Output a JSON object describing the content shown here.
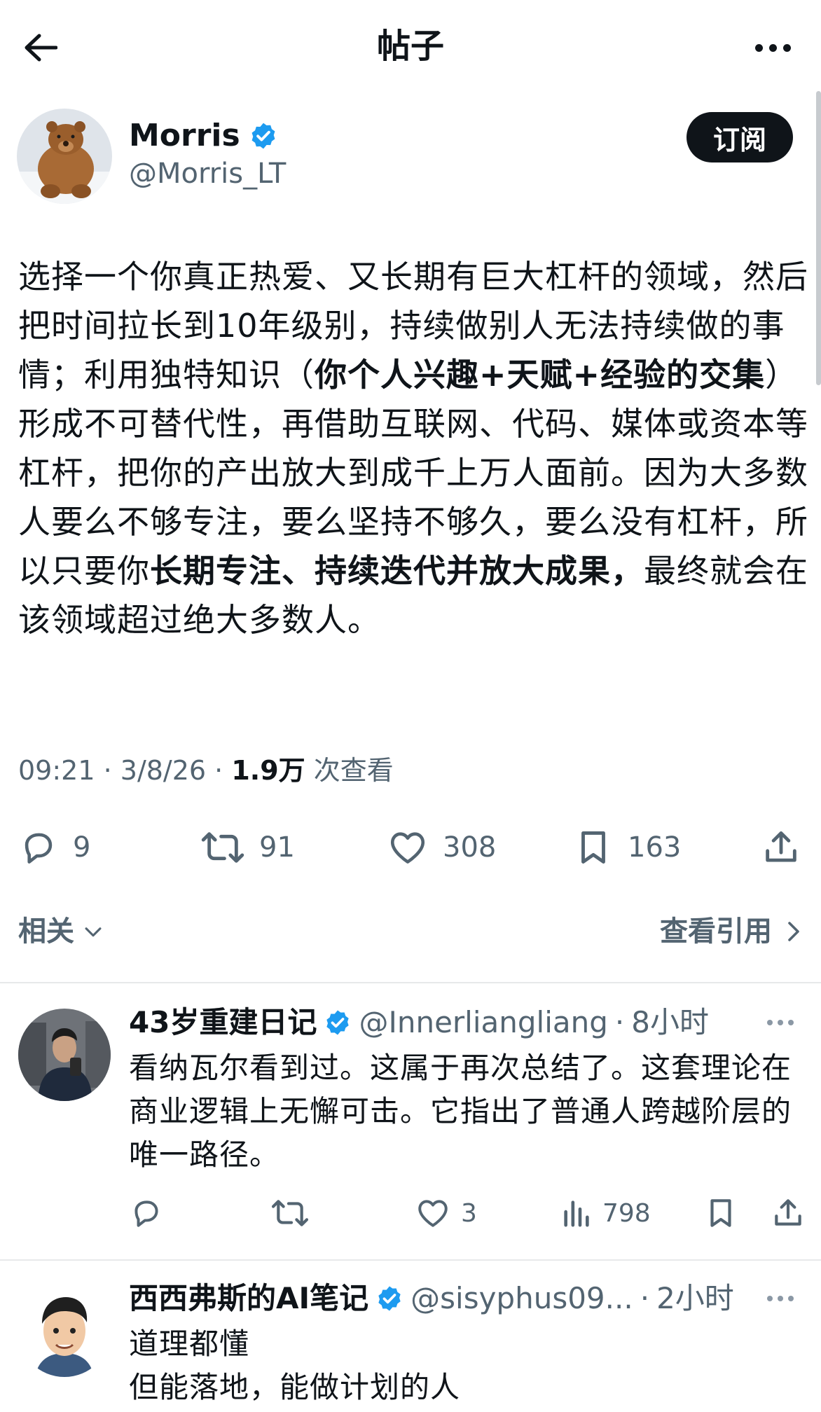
{
  "header": {
    "title": "帖子",
    "back_icon": "arrow-left-icon",
    "more_icon": "more-horizontal-icon"
  },
  "post": {
    "author_name": "Morris",
    "author_handle": "@Morris_LT",
    "subscribe_label": "订阅",
    "body": [
      {
        "text": "选择一个你真正热爱、又长期有巨大杠杆的领域，然后把时间拉长到10年级别，持续做别人无法持续做的事情；利用独特知识（",
        "bold": false
      },
      {
        "text": "你个人兴趣+天赋+经验的交集",
        "bold": true
      },
      {
        "text": "）形成不可替代性，再借助互联网、代码、媒体或资本等杠杆，把你的产出放大到成千上万人面前。因为大多数人要么不够专注，要么坚持不够久，要么没有杠杆，所以只要你",
        "bold": false
      },
      {
        "text": "长期专注、持续迭代并放大成果，",
        "bold": true
      },
      {
        "text": "最终就会在该领域超过绝大多数人。",
        "bold": false
      }
    ],
    "time": "09:21",
    "date": "3/8/26",
    "views_count": "1.9万",
    "views_label": "次查看",
    "replies": "9",
    "reposts": "91",
    "likes": "308",
    "bookmarks": "163",
    "related_label": "相关",
    "view_quotes_label": "查看引用"
  },
  "replies": [
    {
      "name": "43岁重建日记",
      "handle": "@Innerliangliang",
      "time": "8小时",
      "text": "看纳瓦尔看到过。这属于再次总结了。这套理论在商业逻辑上无懈可击。它指出了普通人跨越阶层的唯一路径。",
      "replies": "",
      "reposts": "",
      "likes": "3",
      "views": "798"
    },
    {
      "name": "西西弗斯的AI笔记",
      "handle": "@sisyphus09...",
      "time": "2小时",
      "text_line1": "道理都懂",
      "text_line2": "但能落地，能做计划的人"
    }
  ],
  "colors": {
    "verified": "#1d9bf0",
    "text": "#0f1419",
    "secondary": "#536471",
    "divider": "#e7e9ea"
  }
}
